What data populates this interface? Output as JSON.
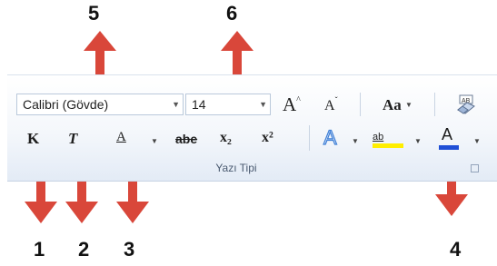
{
  "callouts": {
    "n1": "1",
    "n2": "2",
    "n3": "3",
    "n4": "4",
    "n5": "5",
    "n6": "6"
  },
  "font_group": {
    "font_name": "Calibri (Gövde)",
    "font_size": "14",
    "group_label": "Yazı Tipi",
    "bold_label": "K",
    "italic_label": "T",
    "underline_label": "A",
    "strike_label": "abe",
    "subscript_label": "x₂",
    "superscript_label": "x²",
    "grow_label": "A",
    "shrink_label": "A",
    "case_label": "Aa",
    "highlight_label": "ab",
    "font_color_label": "A",
    "accent_arrow_color": "#d9473a",
    "highlight_color": "#ffee00",
    "font_color": "#1f4fd6"
  }
}
